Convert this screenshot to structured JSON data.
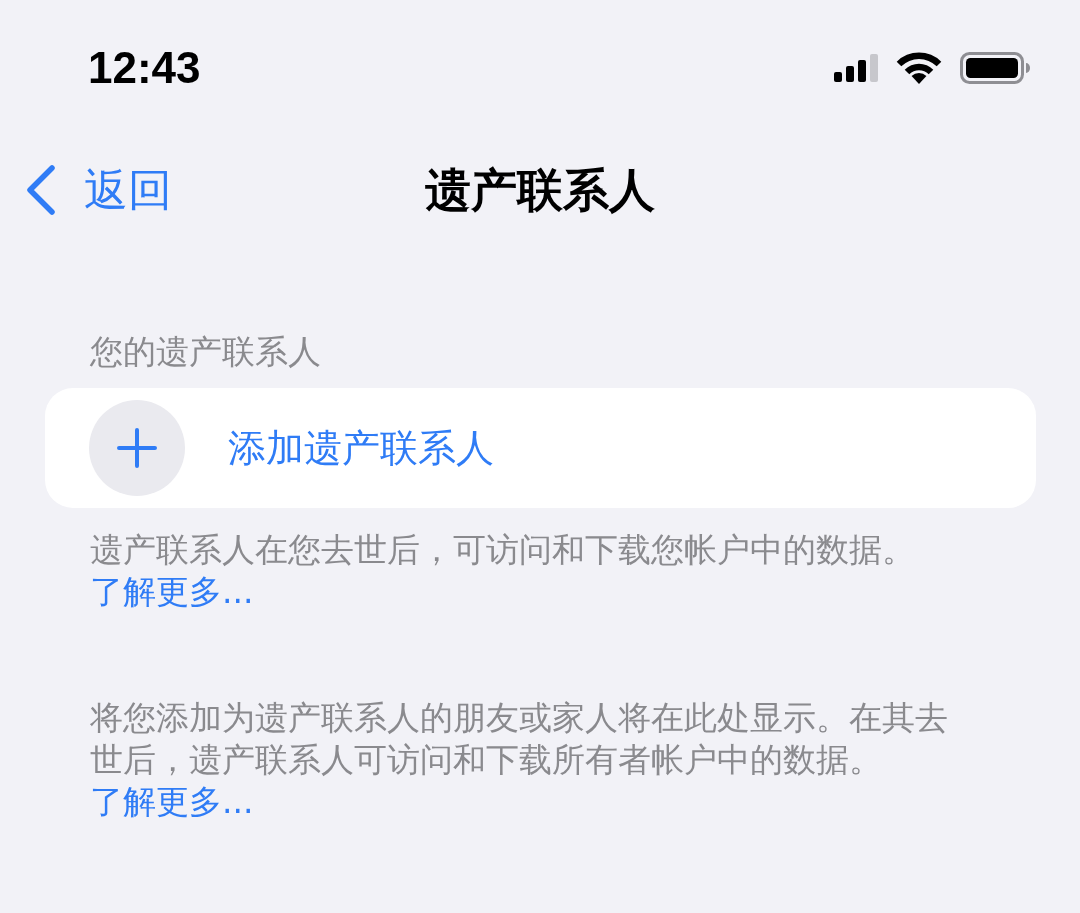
{
  "status_bar": {
    "time": "12:43"
  },
  "nav": {
    "back_label": "返回",
    "title": "遗产联系人"
  },
  "section": {
    "header": "您的遗产联系人",
    "add_button": {
      "label": "添加遗产联系人"
    },
    "footer": {
      "text": "遗产联系人在您去世后，可访问和下载您帐户中的数据。",
      "link": "了解更多..."
    }
  },
  "info": {
    "text": "将您添加为遗产联系人的朋友或家人将在此处显示。在其去世后，遗产联系人可访问和下载所有者帐户中的数据。",
    "link": "了解更多..."
  }
}
